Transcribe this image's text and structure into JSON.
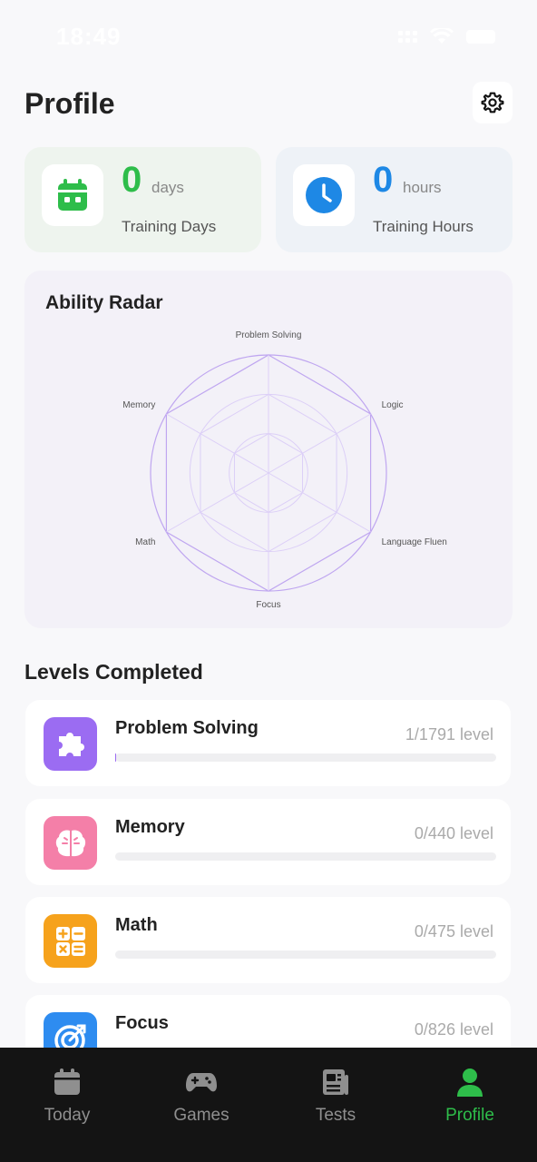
{
  "status_bar": {
    "time": "18:49"
  },
  "header": {
    "title": "Profile",
    "settings_icon": "gear-icon"
  },
  "stats": [
    {
      "value": "0",
      "unit": "days",
      "label": "Training Days",
      "icon": "calendar-icon",
      "color": "#2ebd4a"
    },
    {
      "value": "0",
      "unit": "hours",
      "label": "Training Hours",
      "icon": "clock-icon",
      "color": "#1e88e5"
    }
  ],
  "radar": {
    "title": "Ability Radar",
    "axes": [
      "Problem Solving",
      "Logic",
      "Language Fluen",
      "Focus",
      "Math",
      "Memory"
    ],
    "values": [
      0,
      0,
      0,
      0,
      0,
      0
    ]
  },
  "levels": {
    "title": "Levels Completed",
    "items": [
      {
        "name": "Problem Solving",
        "count": "1/1791 level",
        "progress": 0.0006,
        "icon": "puzzle-icon",
        "color": "#9b6cf2"
      },
      {
        "name": "Memory",
        "count": "0/440 level",
        "progress": 0,
        "icon": "brain-icon",
        "color": "#f47fa8"
      },
      {
        "name": "Math",
        "count": "0/475 level",
        "progress": 0,
        "icon": "calculator-icon",
        "color": "#f6a21c"
      },
      {
        "name": "Focus",
        "count": "0/826 level",
        "progress": 0,
        "icon": "target-icon",
        "color": "#2e8cf0"
      }
    ]
  },
  "tabbar": {
    "tabs": [
      {
        "label": "Today",
        "icon": "calendar-icon",
        "active": false
      },
      {
        "label": "Games",
        "icon": "gamepad-icon",
        "active": false
      },
      {
        "label": "Tests",
        "icon": "newspaper-icon",
        "active": false
      },
      {
        "label": "Profile",
        "icon": "person-icon",
        "active": true
      }
    ],
    "active_color": "#2ebd4a"
  }
}
